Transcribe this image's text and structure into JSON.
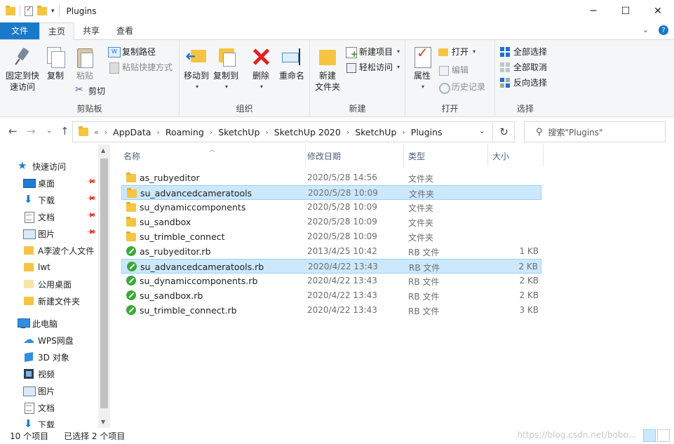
{
  "window": {
    "title": "Plugins",
    "controls": {
      "minimize": "─",
      "maximize": "☐",
      "close": "✕"
    }
  },
  "ribbon_tabs": {
    "file": "文件",
    "home": "主页",
    "share": "共享",
    "view": "查看"
  },
  "ribbon": {
    "clipboard": {
      "label": "剪贴板",
      "pin": "固定到快\n速访问",
      "pin_line1": "固定到快",
      "pin_line2": "速访问",
      "copy": "复制",
      "paste": "粘贴",
      "copy_path": "复制路径",
      "paste_shortcut": "粘贴快捷方式",
      "cut": "剪切"
    },
    "organize": {
      "label": "组织",
      "move_to": "移动到",
      "copy_to": "复制到",
      "delete": "删除",
      "rename": "重命名"
    },
    "new": {
      "label": "新建",
      "new_folder_line1": "新建",
      "new_folder_line2": "文件夹",
      "new_item": "新建项目",
      "easy_access": "轻松访问"
    },
    "open": {
      "label": "打开",
      "properties": "属性",
      "open": "打开",
      "edit": "编辑",
      "history": "历史记录"
    },
    "select": {
      "label": "选择",
      "select_all": "全部选择",
      "select_none": "全部取消",
      "invert": "反向选择"
    }
  },
  "address": {
    "overflow": "«",
    "crumbs": [
      "AppData",
      "Roaming",
      "SketchUp",
      "SketchUp 2020",
      "SketchUp",
      "Plugins"
    ],
    "separator": "›"
  },
  "search": {
    "placeholder": "搜索\"Plugins\""
  },
  "nav": {
    "quick_access": "快速访问",
    "items": [
      {
        "label": "桌面",
        "pinned": true
      },
      {
        "label": "下载",
        "pinned": true
      },
      {
        "label": "文档",
        "pinned": true
      },
      {
        "label": "图片",
        "pinned": true
      },
      {
        "label": "A李波个人文件",
        "pinned": false
      },
      {
        "label": "lwt",
        "pinned": false
      },
      {
        "label": "公用桌面",
        "pinned": false
      },
      {
        "label": "新建文件夹",
        "pinned": false
      }
    ],
    "this_pc": "此电脑",
    "pc_items": [
      {
        "label": "WPS网盘"
      },
      {
        "label": "3D 对象"
      },
      {
        "label": "视频"
      },
      {
        "label": "图片"
      },
      {
        "label": "文档"
      },
      {
        "label": "下载"
      }
    ]
  },
  "columns": {
    "name": "名称",
    "date": "修改日期",
    "type": "类型",
    "size": "大小"
  },
  "files": [
    {
      "name": "as_rubyeditor",
      "date": "2020/5/28 14:56",
      "type": "文件夹",
      "size": "",
      "kind": "folder",
      "selected": false
    },
    {
      "name": "su_advancedcameratools",
      "date": "2020/5/28 10:09",
      "type": "文件夹",
      "size": "",
      "kind": "folder",
      "selected": true
    },
    {
      "name": "su_dynamiccomponents",
      "date": "2020/5/28 10:09",
      "type": "文件夹",
      "size": "",
      "kind": "folder",
      "selected": false
    },
    {
      "name": "su_sandbox",
      "date": "2020/5/28 10:09",
      "type": "文件夹",
      "size": "",
      "kind": "folder",
      "selected": false
    },
    {
      "name": "su_trimble_connect",
      "date": "2020/5/28 10:09",
      "type": "文件夹",
      "size": "",
      "kind": "folder",
      "selected": false
    },
    {
      "name": "as_rubyeditor.rb",
      "date": "2013/4/25 10:42",
      "type": "RB 文件",
      "size": "1 KB",
      "kind": "rb",
      "selected": false
    },
    {
      "name": "su_advancedcameratools.rb",
      "date": "2020/4/22 13:43",
      "type": "RB 文件",
      "size": "2 KB",
      "kind": "rb",
      "selected": true
    },
    {
      "name": "su_dynamiccomponents.rb",
      "date": "2020/4/22 13:43",
      "type": "RB 文件",
      "size": "2 KB",
      "kind": "rb",
      "selected": false
    },
    {
      "name": "su_sandbox.rb",
      "date": "2020/4/22 13:43",
      "type": "RB 文件",
      "size": "2 KB",
      "kind": "rb",
      "selected": false
    },
    {
      "name": "su_trimble_connect.rb",
      "date": "2020/4/22 13:43",
      "type": "RB 文件",
      "size": "3 KB",
      "kind": "rb",
      "selected": false
    }
  ],
  "status": {
    "count": "10 个项目",
    "selected": "已选择 2 个项目",
    "watermark": "https://blog.csdn.net/bobo..."
  },
  "colors": {
    "accent": "#1979ca",
    "selection": "#cce8ff",
    "selection_border": "#99d1ff",
    "folder": "#f5c542",
    "rb_icon": "#3aa93a"
  }
}
